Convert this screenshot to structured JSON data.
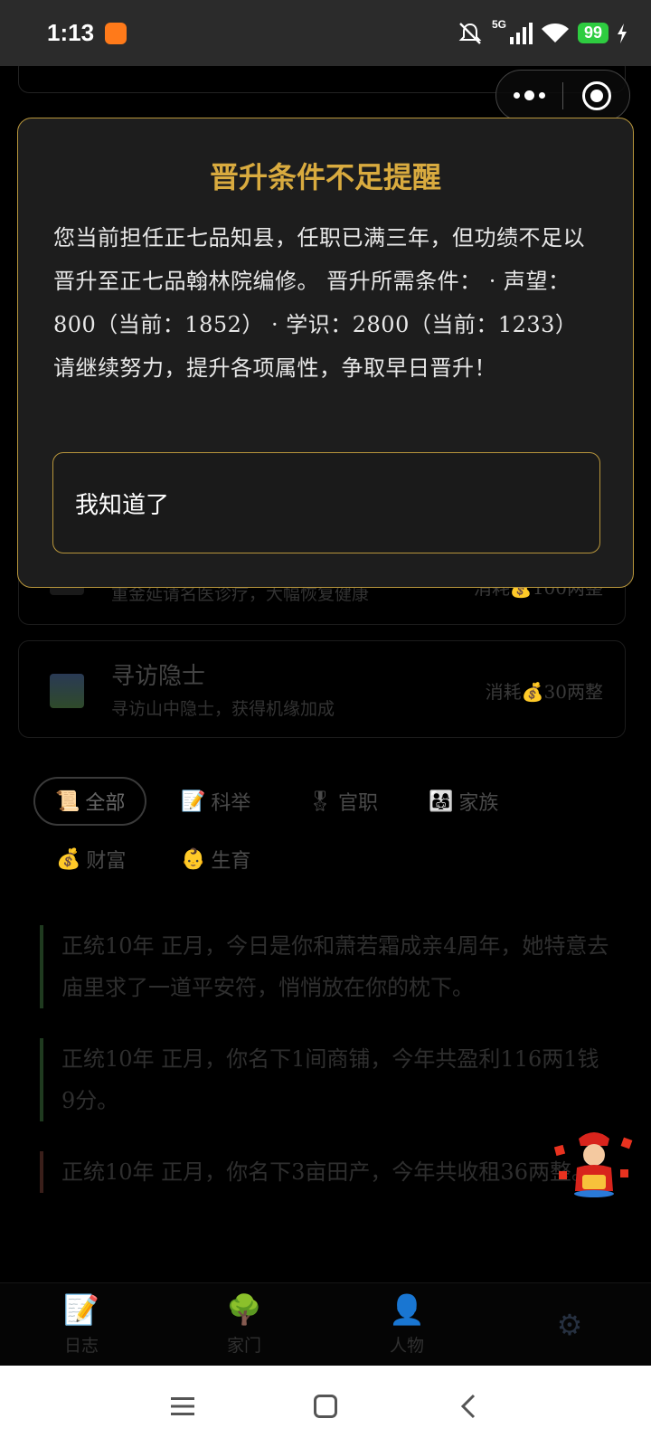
{
  "status_bar": {
    "time": "1:13",
    "network": "5G",
    "battery": "99"
  },
  "capsule": {
    "more_icon": "more-dots-icon",
    "close_icon": "target-close-icon"
  },
  "dialog": {
    "title": "晋升条件不足提醒",
    "body": "您当前担任正七品知县，任职已满三年，但功绩不足以晋升至正七品翰林院编修。 晋升所需条件： · 声望：800（当前：1852） · 学识：2800（当前：1233） 请继续努力，提升各项属性，争取早日晋升！",
    "button_label": "我知道了"
  },
  "background": {
    "cards": [
      {
        "title": "",
        "desc": "重金延请名医诊疗，大幅恢复健康",
        "cost": "消耗💰100两整",
        "icon": "medicine-icon"
      },
      {
        "title": "寻访隐士",
        "desc": "寻访山中隐士，获得机缘加成",
        "cost": "消耗💰30两整",
        "icon": "landscape-icon"
      }
    ],
    "filters": [
      {
        "label": "全部",
        "icon": "📜"
      },
      {
        "label": "科举",
        "icon": "📝"
      },
      {
        "label": "官职",
        "icon": "🎖"
      },
      {
        "label": "家族",
        "icon": "👨‍👩‍👧"
      },
      {
        "label": "财富",
        "icon": "💰"
      },
      {
        "label": "生育",
        "icon": "👶"
      }
    ],
    "logs": [
      "正统10年 正月，今日是你和萧若霜成亲4周年，她特意去庙里求了一道平安符，悄悄放在你的枕下。",
      "正统10年 正月，你名下1间商铺，今年共盈利116两1钱9分。",
      "正统10年 正月，你名下3亩田产，今年共收租36两整。"
    ],
    "tabs": [
      {
        "label": "日志",
        "icon": "📝"
      },
      {
        "label": "家门",
        "icon": "🌳"
      },
      {
        "label": "人物",
        "icon": "👤"
      },
      {
        "label": "",
        "icon": "⚙"
      }
    ]
  },
  "colors": {
    "accent_gold": "#d9ab3f",
    "dialog_border": "#b8963c",
    "dialog_bg": "#1d1d1d",
    "battery_green": "#2ecc40"
  }
}
